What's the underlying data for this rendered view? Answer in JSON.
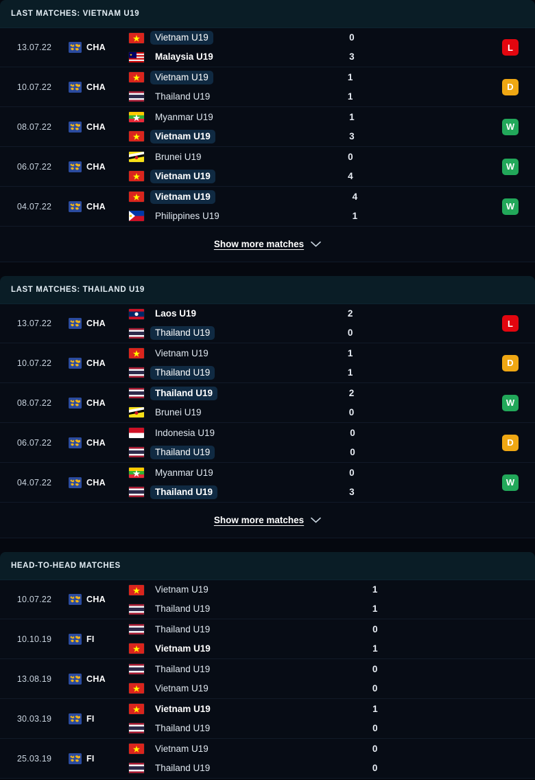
{
  "sections": [
    {
      "id": "last-matches-vietnam",
      "title": "LAST MATCHES: VIETNAM U19",
      "show_more_label": "Show more matches",
      "show_more_icon": "chevron-down-icon",
      "has_results": true,
      "matches": [
        {
          "date": "13.07.22",
          "competition": "CHA",
          "competition_icon": "world-map-icon",
          "home": {
            "team": "Vietnam U19",
            "flag": "vn",
            "highlight": true,
            "bold": false,
            "score": "0"
          },
          "away": {
            "team": "Malaysia U19",
            "flag": "my",
            "highlight": false,
            "bold": true,
            "score": "3"
          },
          "result": "L"
        },
        {
          "date": "10.07.22",
          "competition": "CHA",
          "competition_icon": "world-map-icon",
          "home": {
            "team": "Vietnam U19",
            "flag": "vn",
            "highlight": true,
            "bold": false,
            "score": "1"
          },
          "away": {
            "team": "Thailand U19",
            "flag": "th",
            "highlight": false,
            "bold": false,
            "score": "1"
          },
          "result": "D"
        },
        {
          "date": "08.07.22",
          "competition": "CHA",
          "competition_icon": "world-map-icon",
          "home": {
            "team": "Myanmar U19",
            "flag": "mm",
            "highlight": false,
            "bold": false,
            "score": "1"
          },
          "away": {
            "team": "Vietnam U19",
            "flag": "vn",
            "highlight": true,
            "bold": true,
            "score": "3"
          },
          "result": "W"
        },
        {
          "date": "06.07.22",
          "competition": "CHA",
          "competition_icon": "world-map-icon",
          "home": {
            "team": "Brunei U19",
            "flag": "bn",
            "highlight": false,
            "bold": false,
            "score": "0"
          },
          "away": {
            "team": "Vietnam U19",
            "flag": "vn",
            "highlight": true,
            "bold": true,
            "score": "4"
          },
          "result": "W"
        },
        {
          "date": "04.07.22",
          "competition": "CHA",
          "competition_icon": "world-map-icon",
          "home": {
            "team": "Vietnam U19",
            "flag": "vn",
            "highlight": true,
            "bold": true,
            "score": "4"
          },
          "away": {
            "team": "Philippines U19",
            "flag": "ph",
            "highlight": false,
            "bold": false,
            "score": "1"
          },
          "result": "W"
        }
      ]
    },
    {
      "id": "last-matches-thailand",
      "title": "LAST MATCHES: THAILAND U19",
      "show_more_label": "Show more matches",
      "show_more_icon": "chevron-down-icon",
      "has_results": true,
      "matches": [
        {
          "date": "13.07.22",
          "competition": "CHA",
          "competition_icon": "world-map-icon",
          "home": {
            "team": "Laos U19",
            "flag": "la",
            "highlight": false,
            "bold": true,
            "score": "2"
          },
          "away": {
            "team": "Thailand U19",
            "flag": "th",
            "highlight": true,
            "bold": false,
            "score": "0"
          },
          "result": "L"
        },
        {
          "date": "10.07.22",
          "competition": "CHA",
          "competition_icon": "world-map-icon",
          "home": {
            "team": "Vietnam U19",
            "flag": "vn",
            "highlight": false,
            "bold": false,
            "score": "1"
          },
          "away": {
            "team": "Thailand U19",
            "flag": "th",
            "highlight": true,
            "bold": false,
            "score": "1"
          },
          "result": "D"
        },
        {
          "date": "08.07.22",
          "competition": "CHA",
          "competition_icon": "world-map-icon",
          "home": {
            "team": "Thailand U19",
            "flag": "th",
            "highlight": true,
            "bold": true,
            "score": "2"
          },
          "away": {
            "team": "Brunei U19",
            "flag": "bn",
            "highlight": false,
            "bold": false,
            "score": "0"
          },
          "result": "W"
        },
        {
          "date": "06.07.22",
          "competition": "CHA",
          "competition_icon": "world-map-icon",
          "home": {
            "team": "Indonesia U19",
            "flag": "id",
            "highlight": false,
            "bold": false,
            "score": "0"
          },
          "away": {
            "team": "Thailand U19",
            "flag": "th",
            "highlight": true,
            "bold": false,
            "score": "0"
          },
          "result": "D"
        },
        {
          "date": "04.07.22",
          "competition": "CHA",
          "competition_icon": "world-map-icon",
          "home": {
            "team": "Myanmar U19",
            "flag": "mm",
            "highlight": false,
            "bold": false,
            "score": "0"
          },
          "away": {
            "team": "Thailand U19",
            "flag": "th",
            "highlight": true,
            "bold": true,
            "score": "3"
          },
          "result": "W"
        }
      ]
    },
    {
      "id": "head-to-head",
      "title": "HEAD-TO-HEAD MATCHES",
      "show_more_label": null,
      "show_more_icon": null,
      "has_results": false,
      "matches": [
        {
          "date": "10.07.22",
          "competition": "CHA",
          "competition_icon": "world-map-icon",
          "home": {
            "team": "Vietnam U19",
            "flag": "vn",
            "highlight": false,
            "bold": false,
            "score": "1"
          },
          "away": {
            "team": "Thailand U19",
            "flag": "th",
            "highlight": false,
            "bold": false,
            "score": "1"
          },
          "result": null
        },
        {
          "date": "10.10.19",
          "competition": "FI",
          "competition_icon": "world-map-icon",
          "home": {
            "team": "Thailand U19",
            "flag": "th",
            "highlight": false,
            "bold": false,
            "score": "0"
          },
          "away": {
            "team": "Vietnam U19",
            "flag": "vn",
            "highlight": false,
            "bold": true,
            "score": "1"
          },
          "result": null
        },
        {
          "date": "13.08.19",
          "competition": "CHA",
          "competition_icon": "world-map-icon",
          "home": {
            "team": "Thailand U19",
            "flag": "th",
            "highlight": false,
            "bold": false,
            "score": "0"
          },
          "away": {
            "team": "Vietnam U19",
            "flag": "vn",
            "highlight": false,
            "bold": false,
            "score": "0"
          },
          "result": null
        },
        {
          "date": "30.03.19",
          "competition": "FI",
          "competition_icon": "world-map-icon",
          "home": {
            "team": "Vietnam U19",
            "flag": "vn",
            "highlight": false,
            "bold": true,
            "score": "1"
          },
          "away": {
            "team": "Thailand U19",
            "flag": "th",
            "highlight": false,
            "bold": false,
            "score": "0"
          },
          "result": null
        },
        {
          "date": "25.03.19",
          "competition": "FI",
          "competition_icon": "world-map-icon",
          "home": {
            "team": "Vietnam U19",
            "flag": "vn",
            "highlight": false,
            "bold": false,
            "score": "0"
          },
          "away": {
            "team": "Thailand U19",
            "flag": "th",
            "highlight": false,
            "bold": false,
            "score": "0"
          },
          "result": null
        }
      ]
    }
  ],
  "colors": {
    "win": "#22a85a",
    "draw": "#efa713",
    "loss": "#e3060f",
    "header_bg": "#0a1d26",
    "row_bg": "#070c15",
    "page_bg": "#05080f",
    "highlight_pill": "#102a42"
  }
}
